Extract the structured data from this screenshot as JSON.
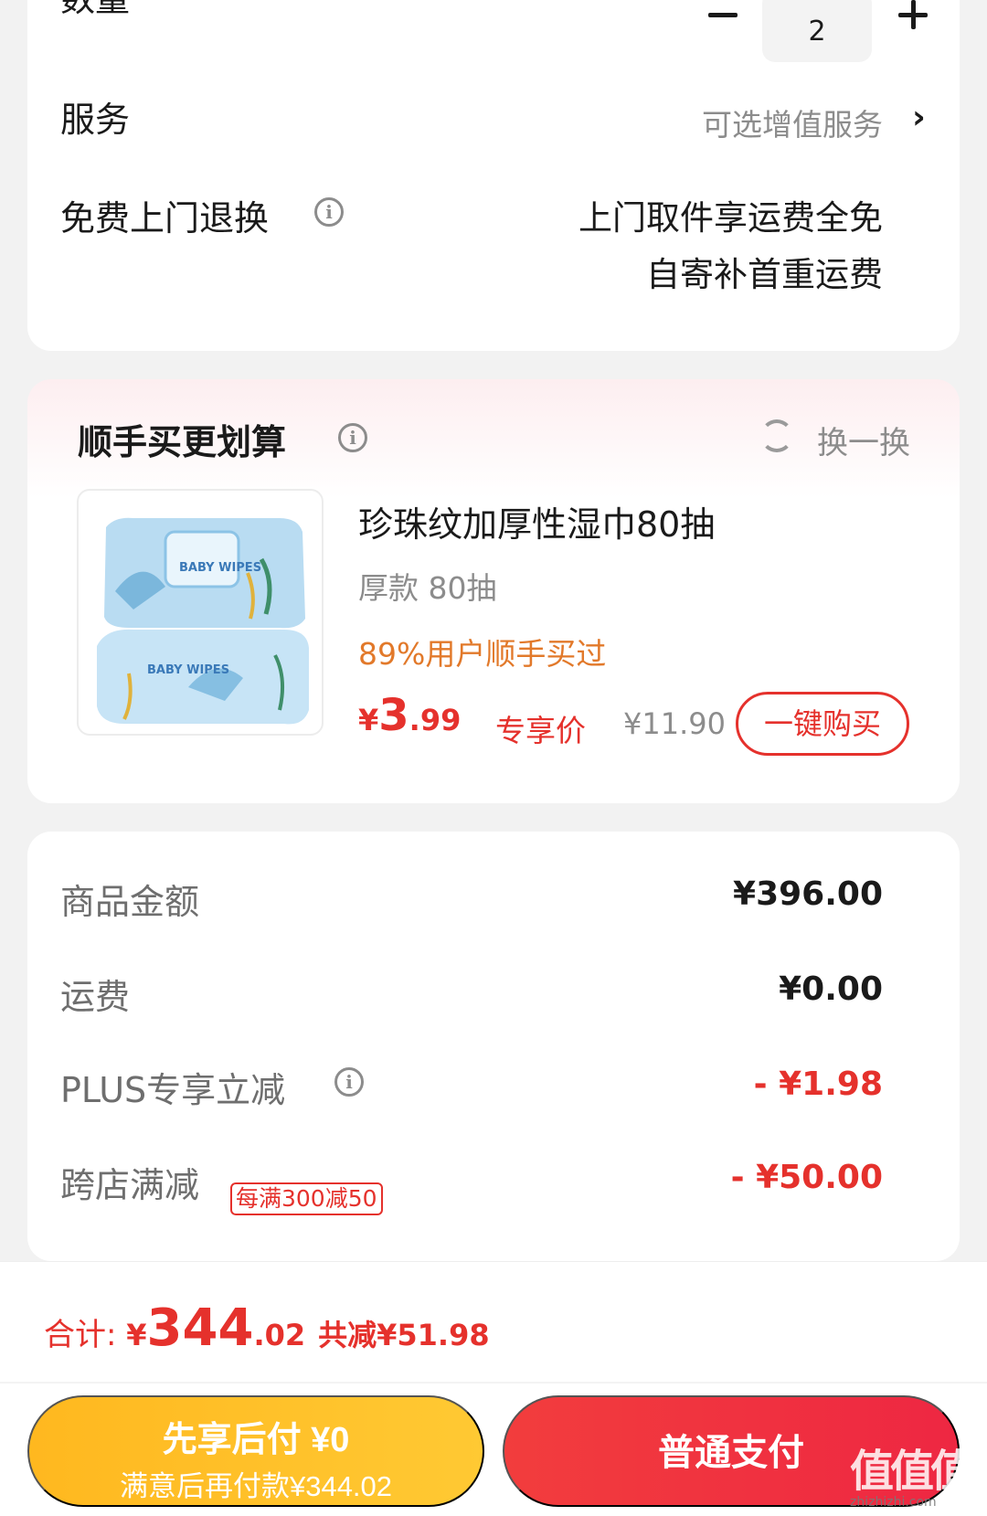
{
  "order": {
    "quantity_label": "数量",
    "quantity_value": "2",
    "service_label": "服务",
    "service_value": "可选增值服务",
    "return_label": "免费上门退换",
    "return_line1": "上门取件享运费全免",
    "return_line2": "自寄补首重运费"
  },
  "addon": {
    "title": "顺手买更划算",
    "swap_label": "换一换",
    "product_name": "珍珠纹加厚性湿巾80抽",
    "spec": "厚款 80抽",
    "popularity": "89%用户顺手买过",
    "price_currency": "¥",
    "price_int": "3",
    "price_dec": ".99",
    "exclusive_label": "专享价",
    "original_price": "¥11.90",
    "buy_button": "一键购买",
    "image_text": "BABY WIPES"
  },
  "amounts": {
    "rows": [
      {
        "label": "商品金额",
        "value": "¥396.00"
      },
      {
        "label": "运费",
        "value": "¥0.00"
      },
      {
        "label": "PLUS专享立减",
        "value": "- ¥1.98"
      },
      {
        "label": "跨店满减",
        "value": "- ¥50.00",
        "tag": "每满300减50"
      }
    ]
  },
  "footer": {
    "total_label": "合计: ",
    "total_currency": "¥",
    "total_int": "344",
    "total_dec": ".02",
    "savings": "共减¥51.98",
    "pay_later_line1": "先享后付 ¥0",
    "pay_later_line2": "满意后再付款¥344.02",
    "pay_normal": "普通支付"
  },
  "watermark": {
    "main": "值值值",
    "sub": "zhizhizhi.com"
  },
  "colors": {
    "accent_red": "#e5312c",
    "orange": "#e2792a",
    "pay_later": "#ffbc25",
    "pay_normal": "#f0303f"
  }
}
